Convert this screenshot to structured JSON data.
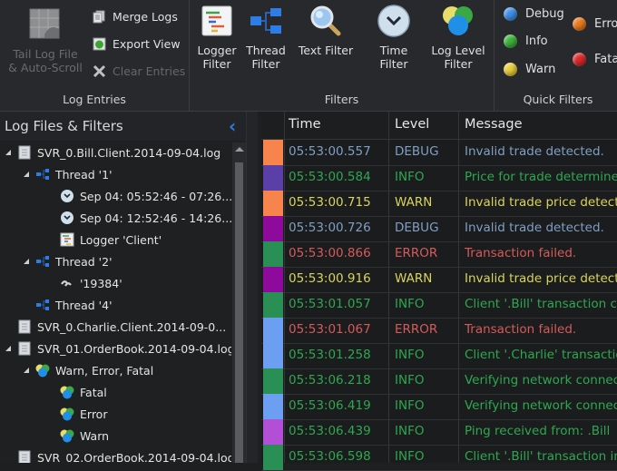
{
  "ribbon": {
    "log_entries": {
      "label": "Log Entries",
      "tail": "Tail Log File\n& Auto-Scroll",
      "tail_line1": "Tail Log File",
      "tail_line2": "& Auto-Scroll",
      "merge": "Merge Logs",
      "export": "Export View",
      "clear": "Clear Entries"
    },
    "filters": {
      "label": "Filters",
      "logger_1": "Logger",
      "logger_2": "Filter",
      "thread_1": "Thread",
      "thread_2": "Filter",
      "text": "Text Filter",
      "time": "Time Filter",
      "level_1": "Log Level",
      "level_2": "Filter"
    },
    "quick_filters": {
      "label": "Quick Filters",
      "debug": "Debug",
      "info": "Info",
      "warn": "Warn",
      "error": "Error",
      "fatal": "Fatal"
    }
  },
  "left_panel": {
    "title": "Log Files & Filters",
    "tree": [
      {
        "label": "SVR_0.Bill.Client.2014-09-04.log",
        "type": "file"
      },
      {
        "label": "Thread '1'",
        "type": "thread"
      },
      {
        "label": "Sep 04: 05:52:46 - 07:26...",
        "type": "time"
      },
      {
        "label": "Sep 04: 12:52:46 - 14:26...",
        "type": "time"
      },
      {
        "label": "Logger 'Client'",
        "type": "logger"
      },
      {
        "label": "Thread '2'",
        "type": "thread"
      },
      {
        "label": "'19384'",
        "type": "text"
      },
      {
        "label": "Thread '4'",
        "type": "thread"
      },
      {
        "label": "SVR_0.Charlie.Client.2014-09-0...",
        "type": "file"
      },
      {
        "label": "SVR_01.OrderBook.2014-09-04.log",
        "type": "file"
      },
      {
        "label": "Warn, Error, Fatal",
        "type": "level"
      },
      {
        "label": "Fatal",
        "type": "level"
      },
      {
        "label": "Error",
        "type": "level"
      },
      {
        "label": "Warn",
        "type": "level"
      },
      {
        "label": "SVR_02.OrderBook.2014-09-04.log",
        "type": "file"
      }
    ]
  },
  "log_table": {
    "columns": [
      "Time",
      "Level",
      "Message"
    ],
    "level_colors": {
      "DEBUG": "#7f9fc4",
      "INFO": "#2ea84f",
      "WARN": "#d9d45a",
      "ERROR": "#d65a5a"
    },
    "rows": [
      {
        "swatch": "#f7834d",
        "time": "05:53:00.557",
        "level": "DEBUG",
        "message": "Invalid trade detected."
      },
      {
        "swatch": "#5a3fa8",
        "time": "05:53:00.584",
        "level": "INFO",
        "message": "Price for trade determined"
      },
      {
        "swatch": "#f7834d",
        "time": "05:53:00.715",
        "level": "WARN",
        "message": "Invalid trade price detected"
      },
      {
        "swatch": "#8e0a9c",
        "time": "05:53:00.726",
        "level": "DEBUG",
        "message": "Invalid trade detected."
      },
      {
        "swatch": "#2a8f55",
        "time": "05:53:00.866",
        "level": "ERROR",
        "message": "Transaction failed."
      },
      {
        "swatch": "#8e0a9c",
        "time": "05:53:00.916",
        "level": "WARN",
        "message": "Invalid trade price detected"
      },
      {
        "swatch": "#2a8f55",
        "time": "05:53:01.057",
        "level": "INFO",
        "message": "Client '.Bill' transaction co"
      },
      {
        "swatch": "#6c9ff2",
        "time": "05:53:01.067",
        "level": "ERROR",
        "message": "Transaction failed."
      },
      {
        "swatch": "#6c9ff2",
        "time": "05:53:01.258",
        "level": "INFO",
        "message": "Client '.Charlie' transaction"
      },
      {
        "swatch": "#2a8f55",
        "time": "05:53:06.218",
        "level": "INFO",
        "message": "Verifying network connection"
      },
      {
        "swatch": "#6c9ff2",
        "time": "05:53:06.419",
        "level": "INFO",
        "message": "Verifying network connection"
      },
      {
        "swatch": "#b24fd6",
        "time": "05:53:06.439",
        "level": "INFO",
        "message": "Ping received from: .Bill"
      },
      {
        "swatch": "#2a8f55",
        "time": "05:53:06.598",
        "level": "INFO",
        "message": "Client '.Bill' transaction in"
      }
    ]
  }
}
